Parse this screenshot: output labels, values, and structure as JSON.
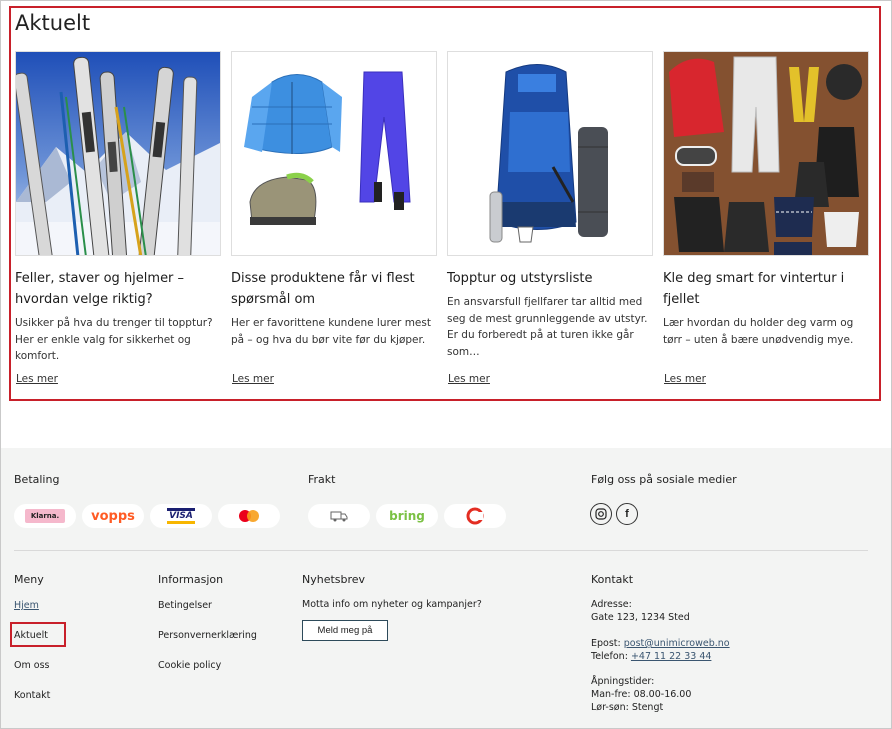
{
  "section": {
    "title": "Aktuelt",
    "cards": [
      {
        "title": "Feller, staver og hjelmer – hvordan velge riktig?",
        "text": "Usikker på hva du trenger til topptur? Her er enkle valg for sikkerhet og komfort.",
        "link": "Les mer"
      },
      {
        "title": "Disse produktene får vi flest spørsmål om",
        "text": "Her er favorittene kundene lurer mest på – og hva du bør vite før du kjøper.",
        "link": "Les mer"
      },
      {
        "title": "Topptur og utstyrsliste",
        "text": "En ansvarsfull fjellfarer tar alltid med seg de mest grunnleggende av utstyr. Er du forberedt på at turen ikke går som…",
        "link": "Les mer"
      },
      {
        "title": "Kle deg smart for vintertur i fjellet",
        "text": "Lær hvordan du holder deg varm og tørr – uten å bære unødvendig mye.",
        "link": "Les mer"
      }
    ]
  },
  "footer": {
    "payment": {
      "heading": "Betaling",
      "logos": [
        "Klarna.",
        "vopps",
        "VISA",
        "mastercard"
      ]
    },
    "shipping": {
      "heading": "Frakt",
      "logos": [
        "truck",
        "bring",
        "posten"
      ]
    },
    "social": {
      "heading": "Følg oss på sosiale medier",
      "icons": [
        "instagram-icon",
        "facebook-icon"
      ]
    },
    "menu": {
      "heading": "Meny",
      "items": [
        "Hjem",
        "Aktuelt",
        "Om oss",
        "Kontakt"
      ]
    },
    "info": {
      "heading": "Informasjon",
      "items": [
        "Betingelser",
        "Personvernerklæring",
        "Cookie policy"
      ]
    },
    "newsletter": {
      "heading": "Nyhetsbrev",
      "text": "Motta info om nyheter og kampanjer?",
      "button": "Meld meg på"
    },
    "contact": {
      "heading": "Kontakt",
      "address_label": "Adresse:",
      "address": "Gate 123, 1234 Sted",
      "email_label": "Epost:",
      "email": "post@unimicroweb.no",
      "phone_label": "Telefon:",
      "phone": "+47 11 22 33 44",
      "hours_label": "Åpningstider:",
      "hours_weekday": "Man-fre: 08.00-16.00",
      "hours_weekend": "Lør-søn: Stengt"
    }
  }
}
